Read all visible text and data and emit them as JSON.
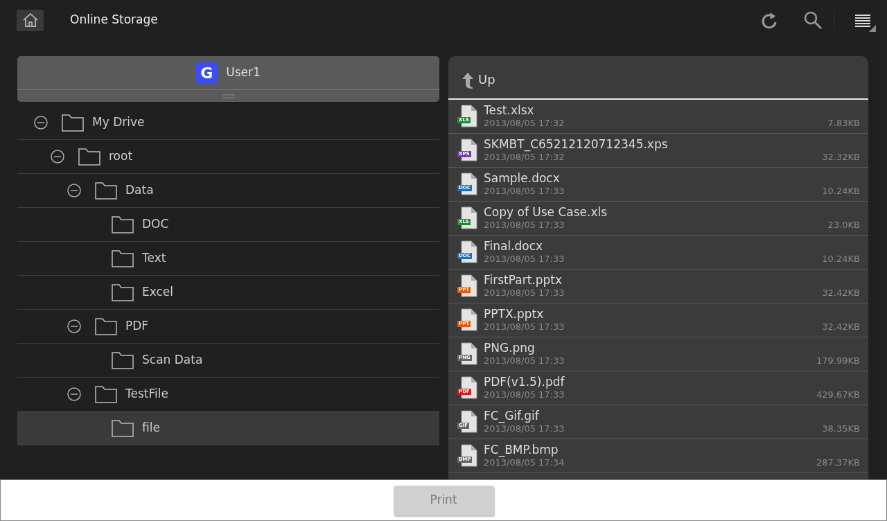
{
  "title": "Online Storage",
  "account": {
    "name": "User1",
    "badge": "G"
  },
  "tree": [
    {
      "label": "My Drive",
      "expanded": true,
      "selected": false,
      "children": [
        {
          "label": "root",
          "expanded": true,
          "selected": false,
          "children": [
            {
              "label": "Data",
              "expanded": true,
              "selected": false,
              "children": [
                {
                  "label": "DOC",
                  "selected": false
                },
                {
                  "label": "Text",
                  "selected": false
                },
                {
                  "label": "Excel",
                  "selected": false
                }
              ]
            },
            {
              "label": "PDF",
              "expanded": true,
              "selected": false,
              "children": [
                {
                  "label": "Scan Data",
                  "selected": false
                }
              ]
            },
            {
              "label": "TestFile",
              "expanded": true,
              "selected": false,
              "children": [
                {
                  "label": "file",
                  "selected": true
                }
              ]
            }
          ]
        }
      ]
    }
  ],
  "up_label": "Up",
  "files": [
    {
      "name": "Test.xlsx",
      "date": "2013/08/05 17:32",
      "size": "7.83KB",
      "badge": "XLS",
      "color": "#1e8a3a"
    },
    {
      "name": "SKMBT_C65212120712345.xps",
      "date": "2013/08/05 17:32",
      "size": "32.32KB",
      "badge": "XPS",
      "color": "#7a3fa0"
    },
    {
      "name": "Sample.docx",
      "date": "2013/08/05 17:33",
      "size": "10.24KB",
      "badge": "DOC",
      "color": "#1a6fc0"
    },
    {
      "name": "Copy of Use Case.xls",
      "date": "2013/08/05 17:33",
      "size": "23.0KB",
      "badge": "XLS",
      "color": "#1e8a3a"
    },
    {
      "name": "Final.docx",
      "date": "2013/08/05 17:33",
      "size": "10.24KB",
      "badge": "DOC",
      "color": "#1a6fc0"
    },
    {
      "name": "FirstPart.pptx",
      "date": "2013/08/05 17:33",
      "size": "32.42KB",
      "badge": "PPT",
      "color": "#e05a10"
    },
    {
      "name": "PPTX.pptx",
      "date": "2013/08/05 17:33",
      "size": "32.42KB",
      "badge": "PPT",
      "color": "#e05a10"
    },
    {
      "name": "PNG.png",
      "date": "2013/08/05 17:33",
      "size": "179.99KB",
      "badge": "PNG",
      "color": "#666666"
    },
    {
      "name": "PDF(v1.5).pdf",
      "date": "2013/08/05 17:33",
      "size": "429.67KB",
      "badge": "PDF",
      "color": "#d01c1c"
    },
    {
      "name": "FC_Gif.gif",
      "date": "2013/08/05 17:33",
      "size": "38.35KB",
      "badge": "GIF",
      "color": "#666666"
    },
    {
      "name": "FC_BMP.bmp",
      "date": "2013/08/05 17:34",
      "size": "287.37KB",
      "badge": "BMP",
      "color": "#666666"
    }
  ],
  "print_button": {
    "label": "Print",
    "disabled": true
  }
}
